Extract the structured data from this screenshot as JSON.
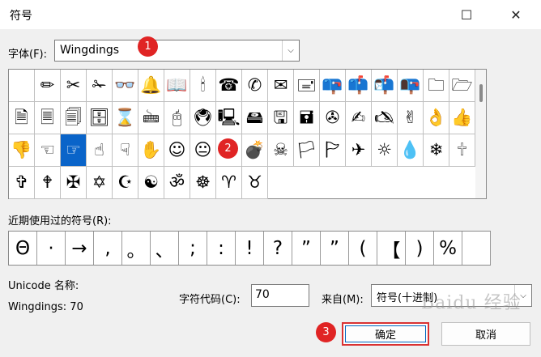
{
  "window": {
    "title": "符号",
    "maximize_glyph": "☐",
    "close_glyph": "✕"
  },
  "font": {
    "label": "字体(F):",
    "value": "Wingdings",
    "arrow": "⌵"
  },
  "grid": {
    "cells": [
      "",
      "✏",
      "✂",
      "✁",
      "👓",
      "🔔",
      "📖",
      "🕯",
      "☎",
      "✆",
      "✉",
      "🖃",
      "📪",
      "📫",
      "📬",
      "📭",
      "🗀",
      "🗁",
      "🗎",
      "🗏",
      "🗐",
      "🗄",
      "⌛",
      "🖮",
      "🖰",
      "🖲",
      "🖳",
      "🖴",
      "🖫",
      "🖬",
      "✇",
      "✍",
      "🖎",
      "✌",
      "👌",
      "👍",
      "👎",
      "☜",
      "☞",
      "☝",
      "☟",
      "✋",
      "☺",
      "😐",
      "☹",
      "💣",
      "☠",
      "🏳",
      "🏱",
      "✈",
      "☼",
      "💧",
      "❄",
      "🕆",
      "✞",
      "🕈",
      "✠",
      "✡",
      "☪",
      "☯",
      "ॐ",
      "☸",
      "♈",
      "♉"
    ],
    "selected_index": 38
  },
  "recent": {
    "label": "近期使用过的符号(R):",
    "symbols": [
      "Θ",
      "·",
      "→",
      ",",
      "。",
      "、",
      ";",
      ":",
      "!",
      "?",
      "”",
      "”",
      "(",
      "【",
      ")",
      "%",
      ""
    ]
  },
  "unicode": {
    "label": "Unicode 名称:",
    "value": "Wingdings: 70"
  },
  "char_code": {
    "label": "字符代码(C):",
    "value": "70"
  },
  "from": {
    "label": "来自(M):",
    "value": "符号(十进制)",
    "arrow": "⌵"
  },
  "buttons": {
    "ok": "确定",
    "cancel": "取消"
  },
  "markers": [
    "1",
    "2",
    "3"
  ],
  "watermark": "Baidu 经验",
  "colors": {
    "selection": "#0a64c9",
    "highlight": "#d93232",
    "marker": "#e02424"
  }
}
